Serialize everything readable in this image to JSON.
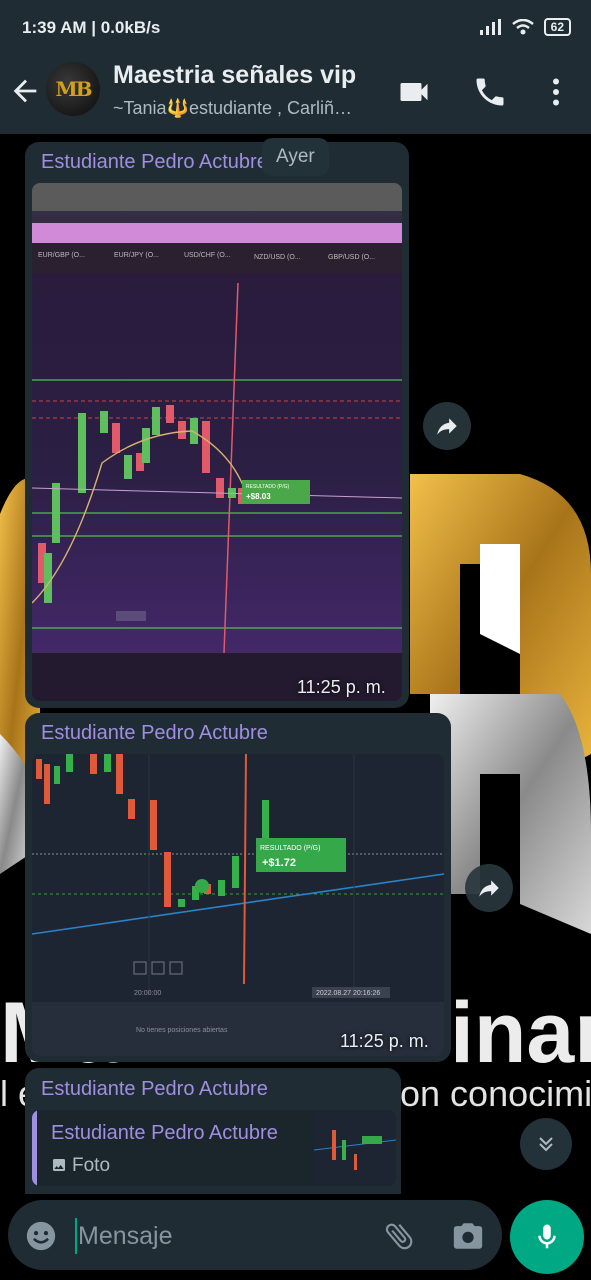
{
  "status": {
    "time": "1:39 AM | 0.0kB/s",
    "battery": "62"
  },
  "header": {
    "title": "Maestria señales vip",
    "subtitle": "~Tania🔱estudiante , Carliñ…",
    "avatar_text": "MB"
  },
  "date_pill": "Ayer",
  "messages": [
    {
      "sender": "Estudiante Pedro Actubre",
      "time": "11:25 p. m.",
      "chart_labels": {
        "result_label": "RESULTADO (P/G)",
        "result_value": "+$8.03"
      },
      "tabs": [
        "EUR/GBP (O...",
        "EUR/JPY (O...",
        "USD/CHF (O...",
        "NZD/USD (O...",
        "GBP/USD (O..."
      ]
    },
    {
      "sender": "Estudiante Pedro Actubre",
      "time": "11:25 p. m.",
      "chart_labels": {
        "result_label": "RESULTADO (P/G)",
        "result_value": "+$1.72",
        "time_left": "20:00:00",
        "time_right": "2022.08.27 20:16:26",
        "footer": "No tienes posiciones abiertas"
      }
    },
    {
      "sender": "Estudiante Pedro Actubre",
      "reply_sender": "Estudiante Pedro Actubre",
      "reply_type": "Foto"
    }
  ],
  "wallpaper": {
    "text_large": "Ma",
    "text_large_right": "inar",
    "text_small_left": "l é",
    "text_small_right": "on conocimie"
  },
  "input": {
    "placeholder": "Mensaje"
  },
  "colors": {
    "bar": "#1f2c34",
    "accent": "#00a884",
    "sender": "#a08ee0"
  }
}
